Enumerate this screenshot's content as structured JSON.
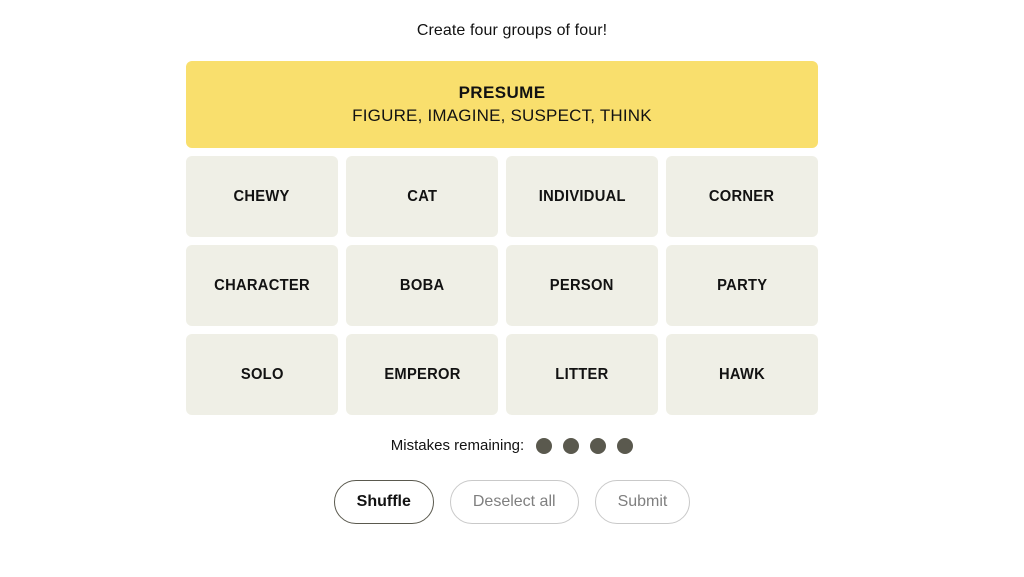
{
  "tagline": "Create four groups of four!",
  "solved_groups": [
    {
      "category": "PRESUME",
      "words": "FIGURE, IMAGINE, SUSPECT, THINK",
      "color": "#f9df6d"
    }
  ],
  "grid": {
    "rows": [
      [
        "CHEWY",
        "CAT",
        "INDIVIDUAL",
        "CORNER"
      ],
      [
        "CHARACTER",
        "BOBA",
        "PERSON",
        "PARTY"
      ],
      [
        "SOLO",
        "EMPEROR",
        "LITTER",
        "HAWK"
      ]
    ],
    "tile_color": "#efefe6"
  },
  "mistakes": {
    "label": "Mistakes remaining:",
    "remaining": 4,
    "dot_color": "#5a594e"
  },
  "actions": {
    "shuffle_label": "Shuffle",
    "deselect_label": "Deselect all",
    "submit_label": "Submit"
  }
}
